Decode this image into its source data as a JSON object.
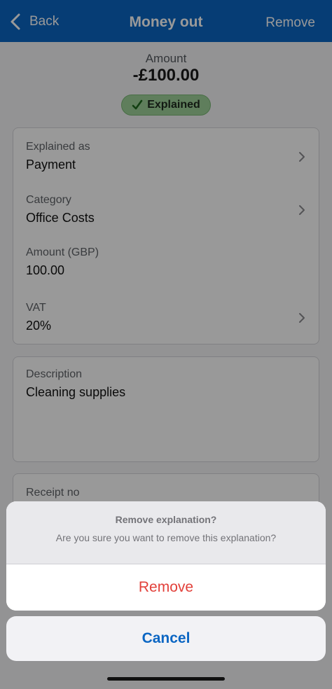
{
  "colors": {
    "nav_bg": "#0b66c3",
    "badge_bg": "#9fd29a",
    "destructive": "#e2403a",
    "link": "#0b66c3"
  },
  "nav": {
    "back_label": "Back",
    "back_icon": "chevron-left-icon",
    "title": "Money out",
    "remove_label": "Remove"
  },
  "summary": {
    "amount_label": "Amount",
    "amount_value": "-£100.00",
    "status": "Explained",
    "status_icon": "checkmark-icon"
  },
  "details": {
    "explained_as": {
      "label": "Explained as",
      "value": "Payment"
    },
    "category": {
      "label": "Category",
      "value": "Office Costs"
    },
    "amount": {
      "label": "Amount (GBP)",
      "value": "100.00"
    },
    "vat": {
      "label": "VAT",
      "value": "20%"
    }
  },
  "description": {
    "label": "Description",
    "value": "Cleaning supplies"
  },
  "receipt": {
    "label": "Receipt no"
  },
  "action_sheet": {
    "title": "Remove explanation?",
    "message": "Are you sure you want to remove this explanation?",
    "confirm_label": "Remove",
    "cancel_label": "Cancel"
  }
}
